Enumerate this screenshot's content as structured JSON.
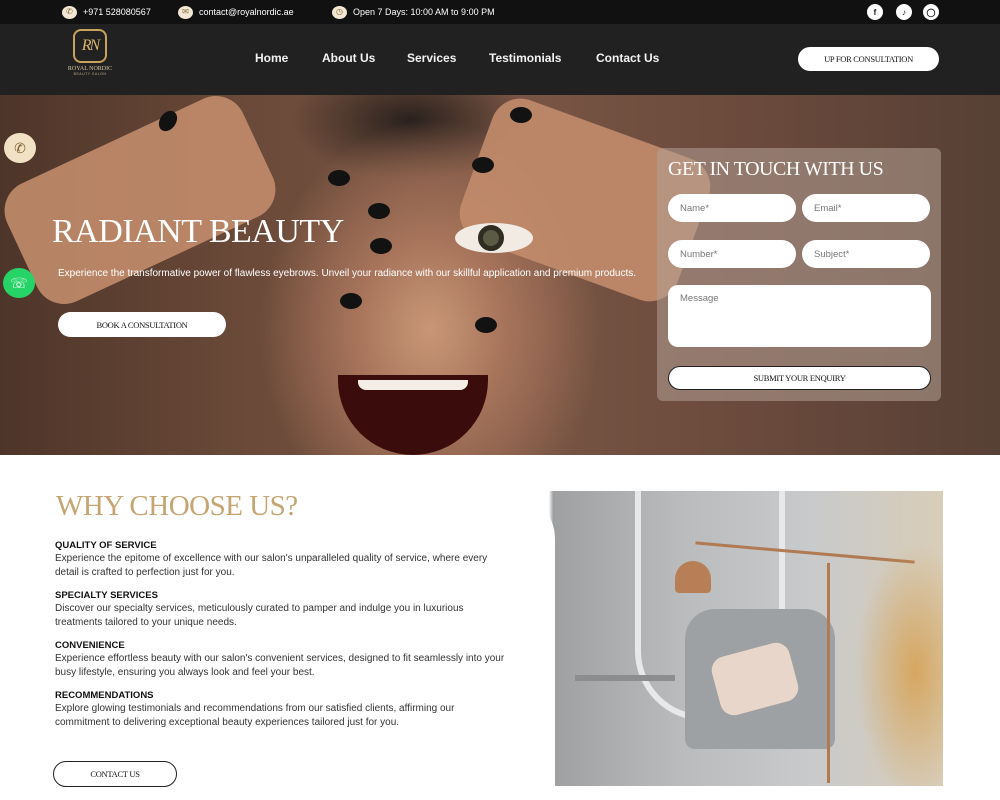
{
  "topbar": {
    "phone": "+971 528080567",
    "email": "contact@royalnordic.ae",
    "hours": "Open 7 Days: 10:00 AM to 9:00 PM",
    "social_icons": [
      "facebook-icon",
      "tiktok-icon",
      "instagram-icon"
    ]
  },
  "header": {
    "logo_monogram": "RN",
    "logo_name": "ROYAL NORDIC",
    "logo_sub": "BEAUTY SALON",
    "nav": [
      "Home",
      "About Us",
      "Services",
      "Testimonials",
      "Contact Us"
    ],
    "cta": "UP FOR CONSULTATION"
  },
  "hero": {
    "title": "RADIANT BEAUTY",
    "description": "Experience the transformative power of flawless eyebrows. Unveil your radiance with our skillful application and premium products.",
    "button": "BOOK A CONSULTATION"
  },
  "form": {
    "title": "GET IN TOUCH WITH US",
    "name_placeholder": "Name*",
    "email_placeholder": "Email*",
    "number_placeholder": "Number*",
    "subject_placeholder": "Subject*",
    "message_placeholder": "Message",
    "submit": "SUBMIT YOUR ENQUIRY"
  },
  "why": {
    "title": "WHY CHOOSE US?",
    "features": [
      {
        "heading": "QUALITY OF SERVICE",
        "text": "Experience the epitome of excellence with our salon's unparalleled quality of service, where every detail is crafted to perfection just for you."
      },
      {
        "heading": "SPECIALTY SERVICES",
        "text": "Discover our specialty services, meticulously curated to pamper and indulge you in luxurious treatments tailored to your unique needs."
      },
      {
        "heading": "CONVENIENCE",
        "text": "Experience effortless beauty with our salon's convenient services, designed to fit seamlessly into your busy lifestyle, ensuring you always look and feel your best."
      },
      {
        "heading": "RECOMMENDATIONS",
        "text": "Explore glowing testimonials and recommendations from our satisfied clients, affirming our commitment to delivering exceptional beauty experiences tailored just for you."
      }
    ],
    "button": "CONTACT US"
  },
  "colors": {
    "accent_gold": "#c5a572",
    "dark": "#212121",
    "whatsapp": "#25d366"
  }
}
